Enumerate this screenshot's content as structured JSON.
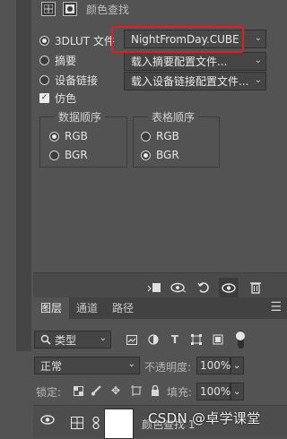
{
  "properties": {
    "header_title": "颜色查找",
    "options": [
      {
        "label": "3DLUT 文件",
        "selected": true,
        "value": "NightFromDay.CUBE"
      },
      {
        "label": "摘要",
        "selected": false,
        "value": "载入摘要配置文件..."
      },
      {
        "label": "设备链接",
        "selected": false,
        "value": "载入设备链接配置文件..."
      }
    ],
    "dither_label": "仿色",
    "data_order": {
      "title": "数据顺序",
      "options": [
        "RGB",
        "BGR"
      ],
      "selected": "RGB"
    },
    "table_order": {
      "title": "表格顺序",
      "options": [
        "RGB",
        "BGR"
      ],
      "selected": "BGR"
    }
  },
  "layers_panel": {
    "tabs": [
      "图层",
      "通道",
      "路径"
    ],
    "active_tab": "图层",
    "filter_kind": "类型",
    "blend_mode": "正常",
    "opacity_label": "不透明度:",
    "opacity_value": "100%",
    "lock_label": "锁定:",
    "fill_label": "填充:",
    "fill_value": "100%",
    "layer_name": "颜色查找 1"
  },
  "watermark": "CSDN @卓学课堂"
}
